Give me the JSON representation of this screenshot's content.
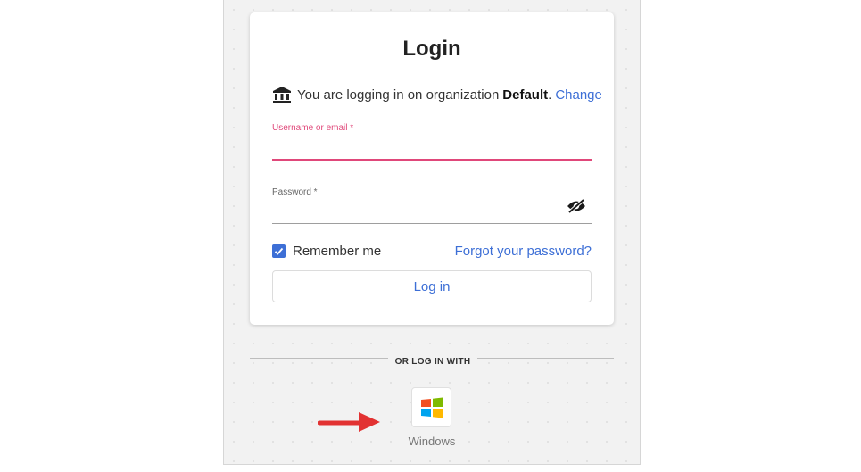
{
  "login_card": {
    "title": "Login",
    "org_prefix": "You are logging in on organization",
    "org_name": "Default",
    "org_suffix": ".",
    "change_link": "Change",
    "username_label": "Username or email *",
    "username_value": "",
    "password_label": "Password *",
    "password_value": "",
    "remember_label": "Remember me",
    "remember_checked": true,
    "forgot_link": "Forgot your password?",
    "login_button": "Log in"
  },
  "alt_login": {
    "divider_text": "OR LOG IN WITH",
    "providers": [
      {
        "label": "Windows",
        "icon": "windows-logo-icon"
      }
    ]
  },
  "colors": {
    "accent": "#3d6fd6",
    "focus_field": "#e0487a",
    "windows_red": "#f25022",
    "windows_green": "#7fba00",
    "windows_blue": "#00a4ef",
    "windows_yellow": "#ffb900",
    "annotation_arrow": "#e23232"
  },
  "icons": {
    "organization": "bank-building-icon",
    "password_visibility": "eye-off-icon",
    "checkbox": "checkmark-icon",
    "annotation": "red-arrow-icon"
  }
}
